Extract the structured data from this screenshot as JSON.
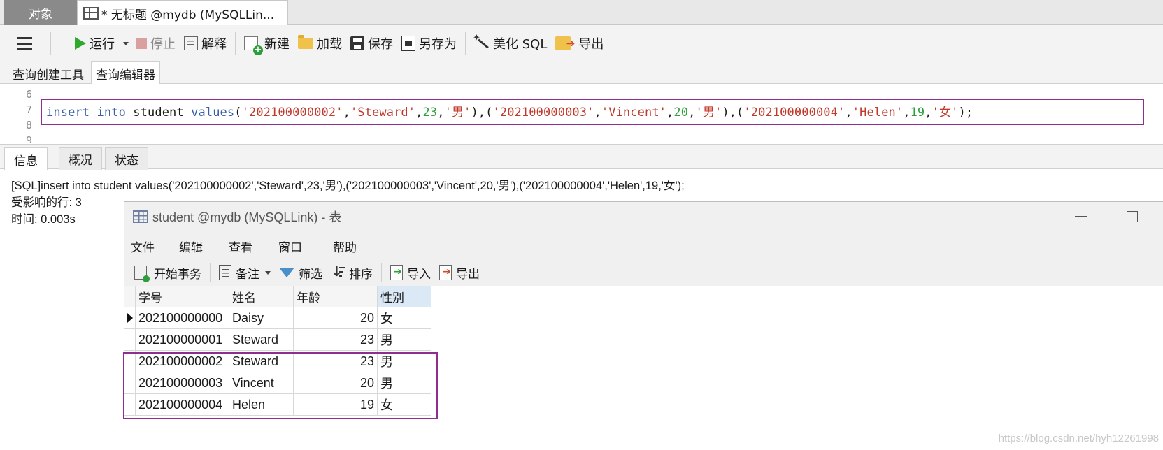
{
  "top_tabs": {
    "objects": "对象",
    "query": "* 无标题 @mydb (MySQLLin..."
  },
  "toolbar": {
    "run": "运行",
    "stop": "停止",
    "explain": "解释",
    "new": "新建",
    "load": "加载",
    "save": "保存",
    "save_as": "另存为",
    "beautify": "美化 SQL",
    "export": "导出"
  },
  "editor_tabs": {
    "builder": "查询创建工具",
    "editor": "查询编辑器"
  },
  "editor": {
    "line_numbers": [
      "6",
      "7",
      "8",
      "9"
    ],
    "tokens": [
      {
        "t": "insert",
        "c": "kw"
      },
      {
        "t": " ",
        "c": "pl"
      },
      {
        "t": "into",
        "c": "kw"
      },
      {
        "t": " student ",
        "c": "pl"
      },
      {
        "t": "values",
        "c": "kw"
      },
      {
        "t": "(",
        "c": "pl"
      },
      {
        "t": "'202100000002'",
        "c": "str"
      },
      {
        "t": ",",
        "c": "pl"
      },
      {
        "t": "'Steward'",
        "c": "str"
      },
      {
        "t": ",",
        "c": "pl"
      },
      {
        "t": "23",
        "c": "num"
      },
      {
        "t": ",",
        "c": "pl"
      },
      {
        "t": "'男'",
        "c": "str"
      },
      {
        "t": "),(",
        "c": "pl"
      },
      {
        "t": "'202100000003'",
        "c": "str"
      },
      {
        "t": ",",
        "c": "pl"
      },
      {
        "t": "'Vincent'",
        "c": "str"
      },
      {
        "t": ",",
        "c": "pl"
      },
      {
        "t": "20",
        "c": "num"
      },
      {
        "t": ",",
        "c": "pl"
      },
      {
        "t": "'男'",
        "c": "str"
      },
      {
        "t": "),(",
        "c": "pl"
      },
      {
        "t": "'202100000004'",
        "c": "str"
      },
      {
        "t": ",",
        "c": "pl"
      },
      {
        "t": "'Helen'",
        "c": "str"
      },
      {
        "t": ",",
        "c": "pl"
      },
      {
        "t": "19",
        "c": "num"
      },
      {
        "t": ",",
        "c": "pl"
      },
      {
        "t": "'女'",
        "c": "str"
      },
      {
        "t": ");",
        "c": "pl"
      }
    ]
  },
  "result_tabs": {
    "info": "信息",
    "overview": "概况",
    "status": "状态"
  },
  "info": {
    "sql": "[SQL]insert into student values('202100000002','Steward',23,'男'),('202100000003','Vincent',20,'男'),('202100000004','Helen',19,'女');",
    "affected": "受影响的行: 3",
    "time": "时间: 0.003s"
  },
  "table_window": {
    "title": "student @mydb (MySQLLink) - 表",
    "menu": [
      "文件",
      "编辑",
      "查看",
      "窗口",
      "帮助"
    ],
    "toolbar": {
      "begin_tx": "开始事务",
      "note": "备注",
      "filter": "筛选",
      "sort": "排序",
      "import": "导入",
      "export": "导出"
    },
    "columns": [
      "学号",
      "姓名",
      "年龄",
      "性别"
    ],
    "rows": [
      [
        "202100000000",
        "Daisy",
        "20",
        "女"
      ],
      [
        "202100000001",
        "Steward",
        "23",
        "男"
      ],
      [
        "202100000002",
        "Steward",
        "23",
        "男"
      ],
      [
        "202100000003",
        "Vincent",
        "20",
        "男"
      ],
      [
        "202100000004",
        "Helen",
        "19",
        "女"
      ]
    ]
  },
  "watermark": "https://blog.csdn.net/hyh12261998"
}
